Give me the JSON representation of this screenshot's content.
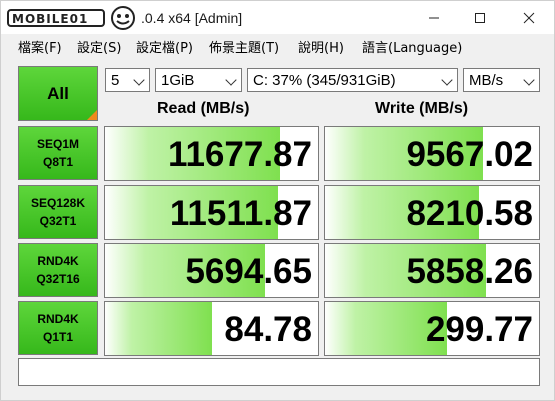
{
  "titlebar": {
    "logo_text": "MOBILE01",
    "title": ".0.4 x64 [Admin]"
  },
  "menu": [
    "檔案(F)",
    "設定(S)",
    "設定檔(P)",
    "佈景主題(T)",
    "說明(H)",
    "語言(Language)"
  ],
  "controls": {
    "all_label": "All",
    "count": "5",
    "size": "1GiB",
    "drive": "C: 37% (345/931GiB)",
    "unit": "MB/s"
  },
  "headers": {
    "read": "Read (MB/s)",
    "write": "Write (MB/s)"
  },
  "rows": [
    {
      "label1": "SEQ1M",
      "label2": "Q8T1",
      "read": "11677.87",
      "write": "9567.02",
      "read_fill": 0.82,
      "write_fill": 0.74
    },
    {
      "label1": "SEQ128K",
      "label2": "Q32T1",
      "read": "11511.87",
      "write": "8210.58",
      "read_fill": 0.81,
      "write_fill": 0.72
    },
    {
      "label1": "RND4K",
      "label2": "Q32T16",
      "read": "5694.65",
      "write": "5858.26",
      "read_fill": 0.75,
      "write_fill": 0.75
    },
    {
      "label1": "RND4K",
      "label2": "Q1T1",
      "read": "84.78",
      "write": "299.77",
      "read_fill": 0.5,
      "write_fill": 0.57
    }
  ],
  "status_text": ""
}
